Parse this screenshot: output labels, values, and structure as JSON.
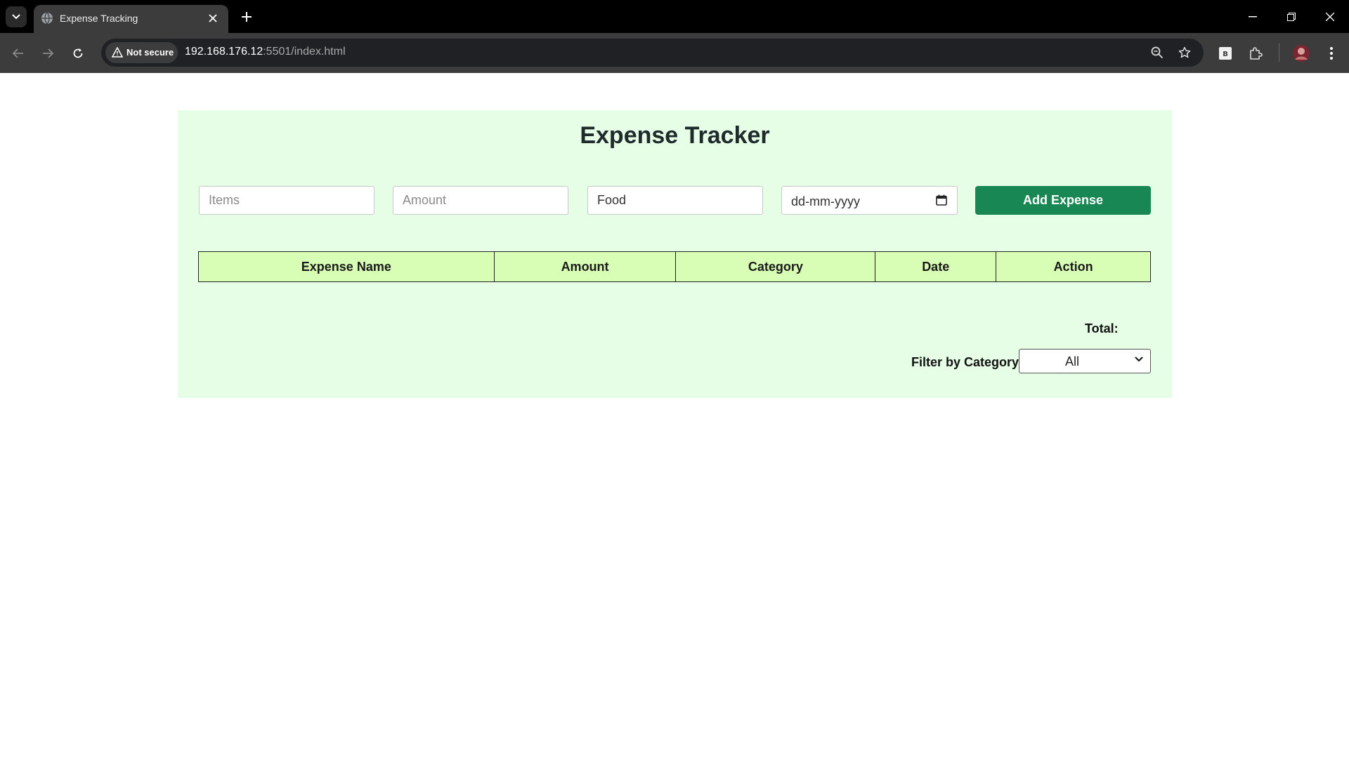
{
  "browser": {
    "tab_title": "Expense Tracking",
    "security_label": "Not secure",
    "url_host": "192.168.176.12",
    "url_rest": ":5501/index.html"
  },
  "app": {
    "title": "Expense Tracker",
    "form": {
      "items_placeholder": "Items",
      "amount_placeholder": "Amount",
      "category_value": "Food",
      "date_placeholder": "dd-mm-yyyy",
      "add_button": "Add Expense"
    },
    "table": {
      "headers": [
        "Expense Name",
        "Amount",
        "Category",
        "Date",
        "Action"
      ]
    },
    "total_label": "Total:",
    "filter": {
      "label": "Filter by Category:",
      "selected": "All"
    }
  },
  "colors": {
    "card_bg": "#e6fde6",
    "header_bg": "#d8fdb4",
    "button_bg": "#198754"
  }
}
